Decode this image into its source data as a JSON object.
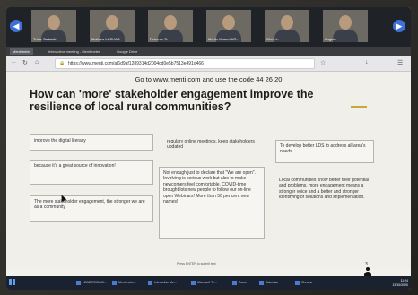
{
  "video_call": {
    "participants": [
      {
        "name": "Triste Sadauki"
      },
      {
        "name": "Mathieu LUCHAS"
      },
      {
        "name": "Petra de S."
      },
      {
        "name": "Martin Maurel UR..."
      },
      {
        "name": "Chris L."
      },
      {
        "name": "Angela"
      }
    ]
  },
  "browser": {
    "tabs": [
      "Mentimeter",
      "Interactive meeting - Mentimeter",
      "Google Drive"
    ],
    "url": "https://www.menti.com/al6d9af1289314d2004cd0e5b7513e491d466",
    "icons": [
      "back-icon",
      "reload-icon",
      "home-icon",
      "lock-icon",
      "bookmark-icon",
      "download-icon",
      "menu-icon"
    ]
  },
  "slide": {
    "instruction": "Go to www.menti.com and use the code 44 26 20",
    "question": "How can 'more' stakeholder engagement improve the resilience of local rural communities?",
    "responses": [
      "improve the digital literacy",
      "regulary online meetings, keep stakeholders updated",
      "To develop better LDS to address all area's needs",
      "because it's a great source of innovation!",
      "Not enough just to declare that \"We are open\". Involving is serious work but also to make newcomers feel comfortable. COVID-time brought lots new people to follow our on-line open Webinars! More than 50 per cent new names!",
      "Local communities know better their potential and problems, more engagement means a stronger voice and a better and stronger identifying of solutions and implementation.",
      "The more stakeholder engagement, the stronger we are as a community"
    ],
    "submissions_note": "Press ENTER to submit text",
    "participant_count": "3"
  },
  "taskbar": {
    "items": [
      "LEADER/CLLD...",
      "Mentimeter...",
      "Interactive Me...",
      "Microsoft Te...",
      "Zoom",
      "Calendar",
      "Chrome"
    ],
    "clock_time": "11:24",
    "clock_date": "13/10/2020"
  }
}
